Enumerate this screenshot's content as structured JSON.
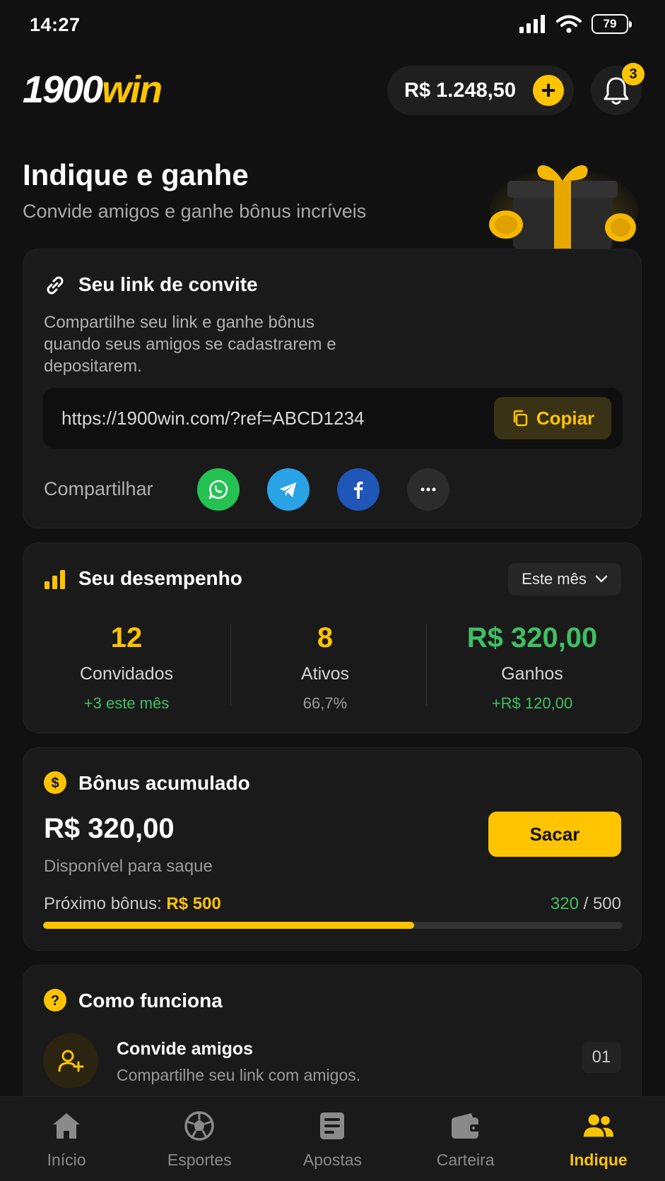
{
  "status_bar": {
    "time": "14:27",
    "battery": "79"
  },
  "header": {
    "logo_part1": "1900",
    "logo_part2": "win",
    "balance": "R$ 1.248,50",
    "notification_count": "3"
  },
  "hero": {
    "title": "Indique e ganhe",
    "subtitle": "Convide amigos e ganhe bônus incríveis"
  },
  "invite": {
    "title": "Seu link de convite",
    "description": "Compartilhe seu link e ganhe bônus quando seus amigos se cadastrarem e depositarem.",
    "link": "https://1900win.com/?ref=ABCD1234",
    "copy_label": "Copiar",
    "share_label": "Compartilhar",
    "share_targets": [
      "whatsapp-icon",
      "telegram-icon",
      "facebook-icon",
      "more-icon"
    ]
  },
  "performance": {
    "title": "Seu desempenho",
    "period": "Este mês",
    "stats": [
      {
        "value": "12",
        "label": "Convidados",
        "sub": "+3 este mês"
      },
      {
        "value": "8",
        "label": "Ativos",
        "sub": "66,7%"
      },
      {
        "value": "R$ 320,00",
        "label": "Ganhos",
        "sub": "+R$ 120,00"
      }
    ]
  },
  "bonus": {
    "title": "Bônus acumulado",
    "amount": "R$ 320,00",
    "subtitle": "Disponível para saque",
    "withdraw_label": "Sacar",
    "next_label": "Próximo bônus:",
    "next_value": "R$ 500",
    "progress_current": "320",
    "progress_sep": " / ",
    "progress_total": "500",
    "progress_fraction": 0.64
  },
  "how_it_works": {
    "title": "Como funciona",
    "steps": [
      {
        "title": "Convide amigos",
        "description": "Compartilhe seu link com amigos.",
        "number": "01"
      }
    ]
  },
  "nav": {
    "items": [
      {
        "label": "Início",
        "icon": "home-icon"
      },
      {
        "label": "Esportes",
        "icon": "soccer-ball-icon"
      },
      {
        "label": "Apostas",
        "icon": "ticket-icon"
      },
      {
        "label": "Carteira",
        "icon": "wallet-icon"
      },
      {
        "label": "Indique",
        "icon": "users-icon"
      }
    ],
    "active_index": 4
  },
  "colors": {
    "accent": "#FFC400",
    "positive": "#3fbf62",
    "background": "#111111",
    "card": "#1a1a1a"
  }
}
